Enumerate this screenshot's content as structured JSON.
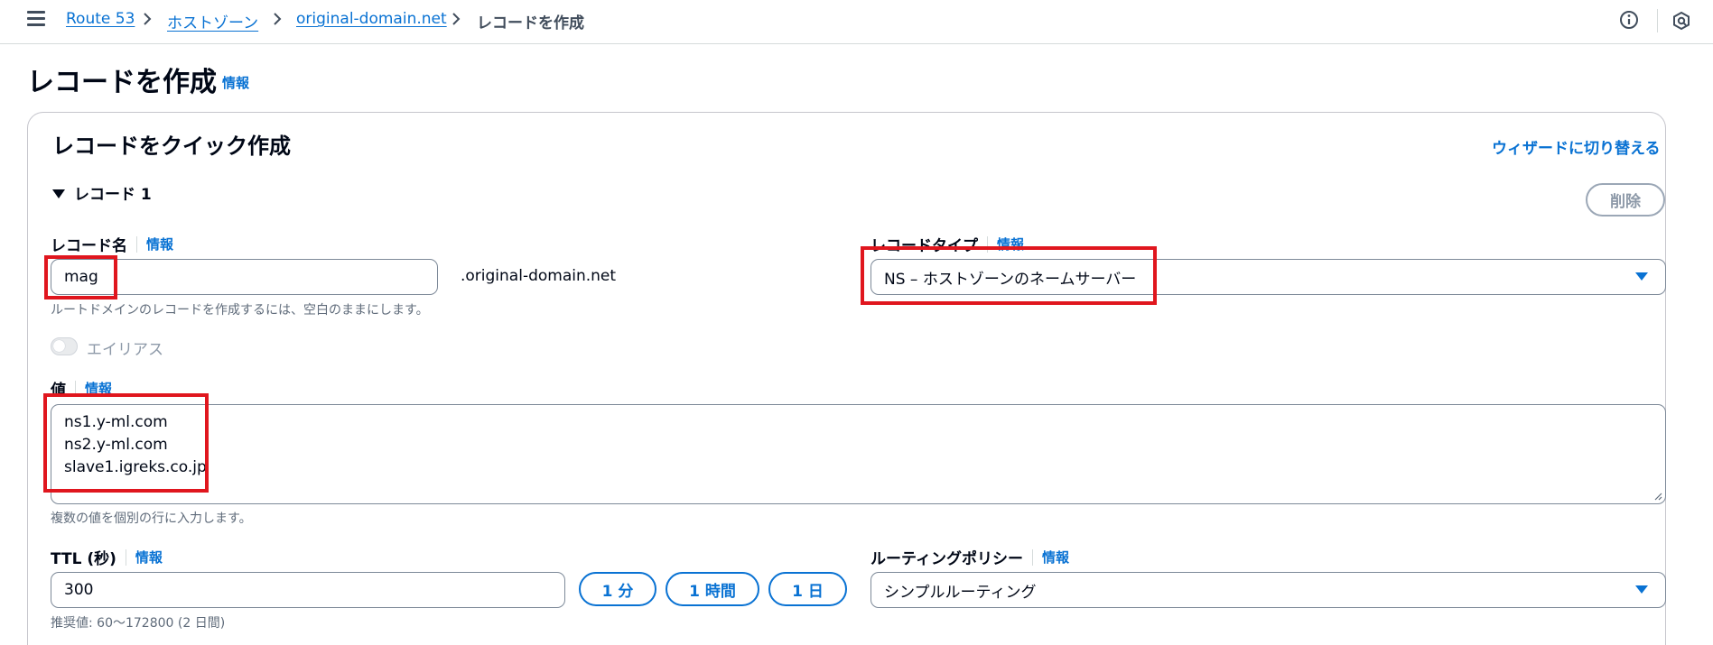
{
  "breadcrumb": {
    "items": [
      "Route 53",
      "ホストゾーン",
      "original-domain.net"
    ],
    "current": "レコードを作成"
  },
  "page": {
    "title": "レコードを作成",
    "title_info": "情報"
  },
  "card": {
    "title": "レコードをクイック作成",
    "wizard_link": "ウィザードに切り替える",
    "record_toggle": "レコード 1",
    "delete_label": "削除"
  },
  "record_name": {
    "label": "レコード名",
    "info": "情報",
    "value": "mag",
    "suffix": ".original-domain.net",
    "hint": "ルートドメインのレコードを作成するには、空白のままにします。"
  },
  "record_type": {
    "label": "レコードタイプ",
    "info": "情報",
    "value": "NS – ホストゾーンのネームサーバー"
  },
  "alias": {
    "label": "エイリアス",
    "enabled": false
  },
  "value_field": {
    "label": "値",
    "info": "情報",
    "lines": [
      "ns1.y-ml.com",
      "ns2.y-ml.com",
      "slave1.igreks.co.jp"
    ],
    "hint": "複数の値を個別の行に入力します。"
  },
  "ttl": {
    "label": "TTL (秒)",
    "info": "情報",
    "value": "300",
    "buttons": [
      "1 分",
      "1 時間",
      "1 日"
    ],
    "hint": "推奨値: 60〜172800 (2 日間)"
  },
  "routing_policy": {
    "label": "ルーティングポリシー",
    "info": "情報",
    "value": "シンプルルーティング"
  },
  "colors": {
    "link": "#0972d3",
    "annotation": "#e0161e",
    "border": "#7d8998"
  }
}
